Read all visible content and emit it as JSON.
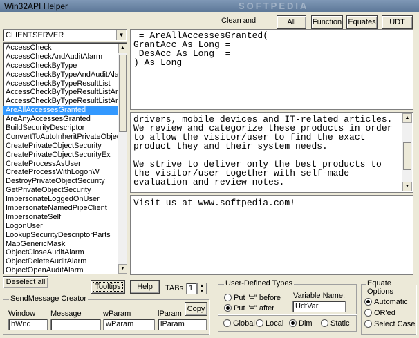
{
  "window": {
    "title": "Win32API Helper",
    "watermark": "SOFTPEDIA"
  },
  "toolbar": {
    "clean_label": "Clean and",
    "buttons": [
      "All",
      "Function",
      "Equates",
      "UDT"
    ]
  },
  "combo": {
    "value": "CLIENTSERVER"
  },
  "list": {
    "items": [
      "AccessCheck",
      "AccessCheckAndAuditAlarm",
      "AccessCheckByType",
      "AccessCheckByTypeAndAuditAla",
      "AccessCheckByTypeResultList",
      "AccessCheckByTypeResultListAr",
      "AccessCheckByTypeResultListAr",
      "AreAllAccessesGranted",
      "AreAnyAccessesGranted",
      "BuildSecurityDescriptor",
      "ConvertToAutoInheritPrivateObjec",
      "CreatePrivateObjectSecurity",
      "CreatePrivateObjectSecurityEx",
      "CreateProcessAsUser",
      "CreateProcessWithLogonW",
      "DestroyPrivateObjectSecurity",
      "GetPrivateObjectSecurity",
      "ImpersonateLoggedOnUser",
      "ImpersonateNamedPipeClient",
      "ImpersonateSelf",
      "LogonUser",
      "LookupSecurityDescriptorParts",
      "MapGenericMask",
      "ObjectCloseAuditAlarm",
      "ObjectDeleteAuditAlarm",
      "ObjectOpenAuditAlarm"
    ],
    "selected": "AreAllAccessesGranted"
  },
  "editor_top": {
    "text": " = AreAllAccessesGranted(\nGrantAcc As Long =\n DesAcc As Long  =\n) As Long"
  },
  "editor_mid": {
    "text": "drivers, mobile devices and IT-related articles.\nWe review and categorize these products in order\nto allow the visitor/user to find the exact\nproduct they and their system needs.\n\nWe strive to deliver only the best products to\nthe visitor/user together with self-made\nevaluation and review notes."
  },
  "editor_bot": {
    "text": "Visit us at www.softpedia.com!"
  },
  "bottom": {
    "deselect_label": "Deselect all",
    "tooltips_label": "Tooltips",
    "help_label": "Help",
    "tabs_label": "TABs",
    "tabs_value": "1"
  },
  "sendmessage": {
    "title": "SendMessage Creator",
    "copy_label": "Copy",
    "col_labels": [
      "Window",
      "Message",
      "wParam",
      "lParam"
    ],
    "values": [
      "hWnd",
      "",
      "wParam",
      "lParam"
    ]
  },
  "udt_group": {
    "title": "User-Defined Types",
    "radio_before": "Put \"=\" before",
    "radio_after": "Put \"=\" after",
    "varname_label": "Variable Name:",
    "varname_value": "UdtVar",
    "scope": [
      "Global",
      "Local",
      "Dim",
      "Static"
    ],
    "scope_selected": "Dim"
  },
  "equate_group": {
    "title": "Equate Options",
    "options": [
      "Automatic",
      "OR'ed",
      "Select Case"
    ],
    "selected": "Automatic"
  }
}
